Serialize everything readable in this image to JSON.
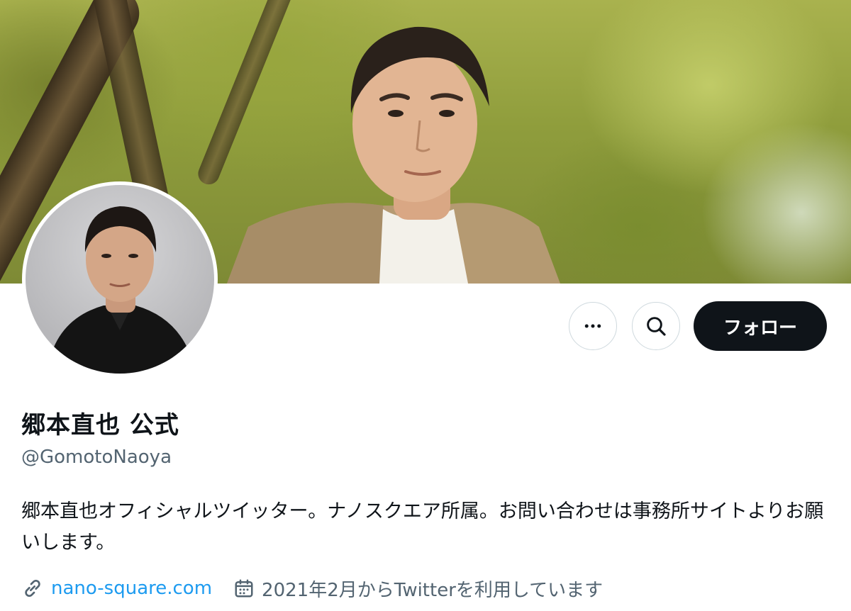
{
  "profile": {
    "display_name": "郷本直也 公式",
    "handle": "@GomotoNaoya",
    "bio": "郷本直也オフィシャルツイッター。ナノスクエア所属。お問い合わせは事務所サイトよりお願いします。",
    "website": "nano-square.com",
    "joined": "2021年2月からTwitterを利用しています"
  },
  "actions": {
    "more_icon": "more-horizontal-icon",
    "search_icon": "search-icon",
    "follow_label": "フォロー"
  },
  "icons": {
    "link": "link-icon",
    "calendar": "calendar-icon"
  },
  "colors": {
    "text_primary": "#0f1419",
    "text_secondary": "#536471",
    "link": "#1d9bf0",
    "follow_bg": "#0f1419",
    "border": "#cfd9de"
  }
}
